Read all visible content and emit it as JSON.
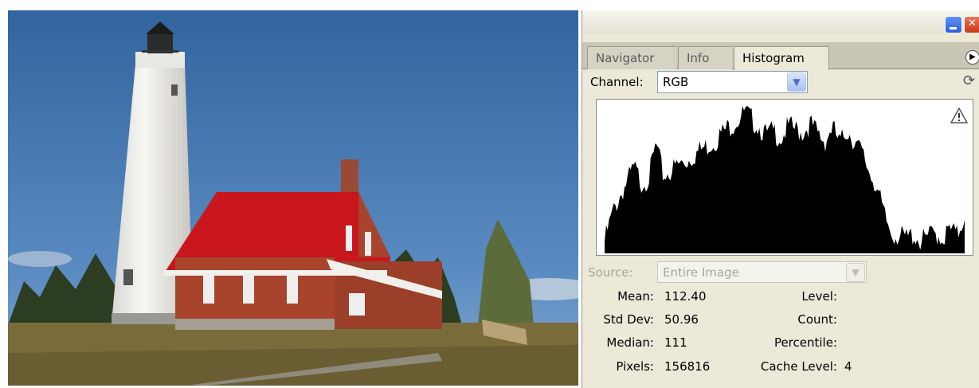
{
  "panel": {
    "tabs": [
      {
        "label": "Navigator"
      },
      {
        "label": "Info"
      },
      {
        "label": "Histogram"
      }
    ],
    "channel": {
      "label": "Channel:",
      "value": "RGB"
    },
    "source": {
      "label": "Source:",
      "value": "Entire Image"
    },
    "stats": {
      "mean": {
        "label": "Mean:",
        "value": "112.40"
      },
      "std_dev": {
        "label": "Std Dev:",
        "value": "50.96"
      },
      "median": {
        "label": "Median:",
        "value": "111"
      },
      "pixels": {
        "label": "Pixels:",
        "value": "156816"
      },
      "level": {
        "label": "Level:",
        "value": ""
      },
      "count": {
        "label": "Count:",
        "value": ""
      },
      "percentile": {
        "label": "Percentile:",
        "value": ""
      },
      "cache_level": {
        "label": "Cache Level:",
        "value": "4"
      }
    },
    "icons": {
      "refresh": "refresh-icon",
      "warning": "warning-icon",
      "panel_menu": "panel-menu-icon",
      "minimize": "minimize-icon",
      "close": "close-icon"
    }
  },
  "histogram": {
    "channel": "RGB",
    "levels_shape": [
      0.12,
      0.3,
      0.42,
      0.52,
      0.62,
      0.52,
      0.55,
      0.78,
      0.56,
      0.6,
      0.64,
      0.66,
      0.7,
      0.74,
      0.77,
      0.8,
      0.86,
      0.9,
      0.94,
      1.0,
      0.95,
      0.9,
      0.84,
      0.87,
      0.82,
      0.9,
      0.88,
      0.86,
      0.92,
      0.85,
      0.8,
      0.9,
      0.78,
      0.88,
      0.8,
      0.72,
      0.6,
      0.5,
      0.3,
      0.18,
      0.16,
      0.14,
      0.17,
      0.12,
      0.15,
      0.18,
      0.14,
      0.2,
      0.16,
      0.3
    ],
    "colors": {
      "fill": "#000000",
      "background": "#ffffff"
    }
  },
  "colors": {
    "panel_bg": "#ece9d8",
    "sky": "#3e6ea6",
    "roof": "#c8161c",
    "brick": "#a8432c",
    "grass": "#6a6331"
  }
}
